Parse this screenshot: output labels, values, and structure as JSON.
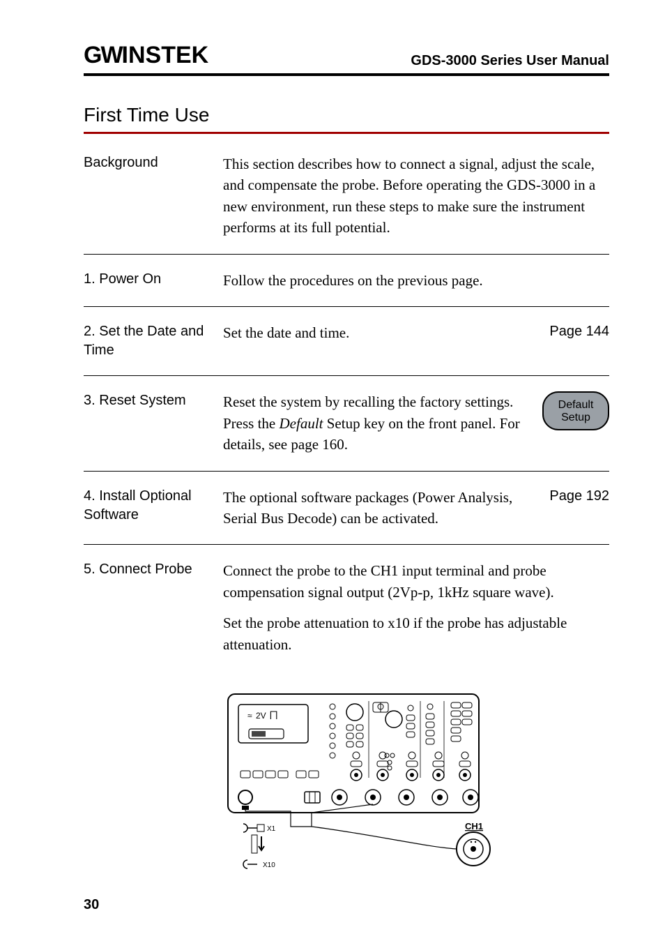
{
  "header": {
    "brand_gw": "GW",
    "brand_instek": "INSTEK",
    "manual_title": "GDS-3000 Series User Manual"
  },
  "section_title": "First Time Use",
  "rows": [
    {
      "left": "Background",
      "body": "This section describes how to connect a signal, adjust the scale, and compensate the probe. Before operating the GDS-3000 in a new environment, run these steps to make sure the instrument performs at its full potential.",
      "side": ""
    },
    {
      "left": "1. Power On",
      "body": "Follow the procedures on the previous page.",
      "side": ""
    },
    {
      "left": "2. Set the Date and Time",
      "body": "Set the date and time.",
      "side": "Page 144"
    },
    {
      "left": "3. Reset System",
      "body_pre": "Reset the system by recalling the factory settings. Press the ",
      "body_italic": "Default",
      "body_post": " Setup key on the front panel. For details, see page 160.",
      "button_line1": "Default",
      "button_line2": "Setup"
    },
    {
      "left": "4. Install Optional Software",
      "body": "The optional software packages (Power Analysis, Serial Bus Decode) can be activated.",
      "side": "Page 192"
    },
    {
      "left": "5. Connect Probe",
      "body": "Connect the probe to the CH1 input terminal and probe compensation signal output (2Vp-p, 1kHz square wave).",
      "body2": "Set the probe attenuation to x10 if the probe has adjustable attenuation."
    }
  ],
  "diagram": {
    "wave_label": "2V",
    "ch1_label": "CH1",
    "probe_x1": "X1",
    "probe_x10": "X10",
    "wave_icon": "≈",
    "pulse_icon": "⨅"
  },
  "page_number": "30"
}
